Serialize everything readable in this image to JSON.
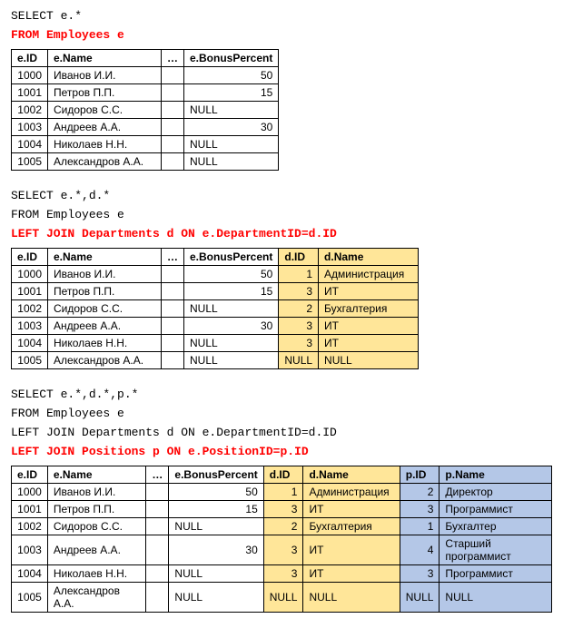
{
  "block1": {
    "sql": [
      {
        "text": "SELECT e.*",
        "highlight": false
      },
      {
        "text": "FROM Employees e",
        "highlight": true
      }
    ],
    "headers": {
      "eid": "e.ID",
      "ename": "e.Name",
      "ell": "…",
      "ebonus": "e.BonusPercent"
    },
    "rows": [
      {
        "eid": "1000",
        "ename": "Иванов И.И.",
        "ell": "",
        "ebonus": "50"
      },
      {
        "eid": "1001",
        "ename": "Петров П.П.",
        "ell": "",
        "ebonus": "15"
      },
      {
        "eid": "1002",
        "ename": "Сидоров С.С.",
        "ell": "",
        "ebonus": "NULL"
      },
      {
        "eid": "1003",
        "ename": "Андреев А.А.",
        "ell": "",
        "ebonus": "30"
      },
      {
        "eid": "1004",
        "ename": "Николаев Н.Н.",
        "ell": "",
        "ebonus": "NULL"
      },
      {
        "eid": "1005",
        "ename": "Александров А.А.",
        "ell": "",
        "ebonus": "NULL"
      }
    ]
  },
  "block2": {
    "sql": [
      {
        "text": "SELECT e.*,d.*",
        "highlight": false
      },
      {
        "text": "FROM Employees e",
        "highlight": false
      },
      {
        "text": "LEFT JOIN Departments d ON e.DepartmentID=d.ID",
        "highlight": true
      }
    ],
    "headers": {
      "eid": "e.ID",
      "ename": "e.Name",
      "ell": "…",
      "ebonus": "e.BonusPercent",
      "did": "d.ID",
      "dname": "d.Name"
    },
    "rows": [
      {
        "eid": "1000",
        "ename": "Иванов И.И.",
        "ell": "",
        "ebonus": "50",
        "did": "1",
        "dname": "Администрация"
      },
      {
        "eid": "1001",
        "ename": "Петров П.П.",
        "ell": "",
        "ebonus": "15",
        "did": "3",
        "dname": "ИТ"
      },
      {
        "eid": "1002",
        "ename": "Сидоров С.С.",
        "ell": "",
        "ebonus": "NULL",
        "did": "2",
        "dname": "Бухгалтерия"
      },
      {
        "eid": "1003",
        "ename": "Андреев А.А.",
        "ell": "",
        "ebonus": "30",
        "did": "3",
        "dname": "ИТ"
      },
      {
        "eid": "1004",
        "ename": "Николаев Н.Н.",
        "ell": "",
        "ebonus": "NULL",
        "did": "3",
        "dname": "ИТ"
      },
      {
        "eid": "1005",
        "ename": "Александров А.А.",
        "ell": "",
        "ebonus": "NULL",
        "did": "NULL",
        "dname": "NULL"
      }
    ]
  },
  "block3": {
    "sql": [
      {
        "text": "SELECT e.*,d.*,p.*",
        "highlight": false
      },
      {
        "text": "FROM Employees e",
        "highlight": false
      },
      {
        "text": "LEFT JOIN Departments d ON e.DepartmentID=d.ID",
        "highlight": false
      },
      {
        "text": "LEFT JOIN Positions p ON e.PositionID=p.ID",
        "highlight": true
      }
    ],
    "headers": {
      "eid": "e.ID",
      "ename": "e.Name",
      "ell": "…",
      "ebonus": "e.BonusPercent",
      "did": "d.ID",
      "dname": "d.Name",
      "pid": "p.ID",
      "pname": "p.Name"
    },
    "rows": [
      {
        "eid": "1000",
        "ename": "Иванов И.И.",
        "ell": "",
        "ebonus": "50",
        "did": "1",
        "dname": "Администрация",
        "pid": "2",
        "pname": "Директор"
      },
      {
        "eid": "1001",
        "ename": "Петров П.П.",
        "ell": "",
        "ebonus": "15",
        "did": "3",
        "dname": "ИТ",
        "pid": "3",
        "pname": "Программист"
      },
      {
        "eid": "1002",
        "ename": "Сидоров С.С.",
        "ell": "",
        "ebonus": "NULL",
        "did": "2",
        "dname": "Бухгалтерия",
        "pid": "1",
        "pname": "Бухгалтер"
      },
      {
        "eid": "1003",
        "ename": "Андреев А.А.",
        "ell": "",
        "ebonus": "30",
        "did": "3",
        "dname": "ИТ",
        "pid": "4",
        "pname": "Старший программист"
      },
      {
        "eid": "1004",
        "ename": "Николаев Н.Н.",
        "ell": "",
        "ebonus": "NULL",
        "did": "3",
        "dname": "ИТ",
        "pid": "3",
        "pname": "Программист"
      },
      {
        "eid": "1005",
        "ename": "Александров А.А.",
        "ell": "",
        "ebonus": "NULL",
        "did": "NULL",
        "dname": "NULL",
        "pid": "NULL",
        "pname": "NULL"
      }
    ]
  }
}
